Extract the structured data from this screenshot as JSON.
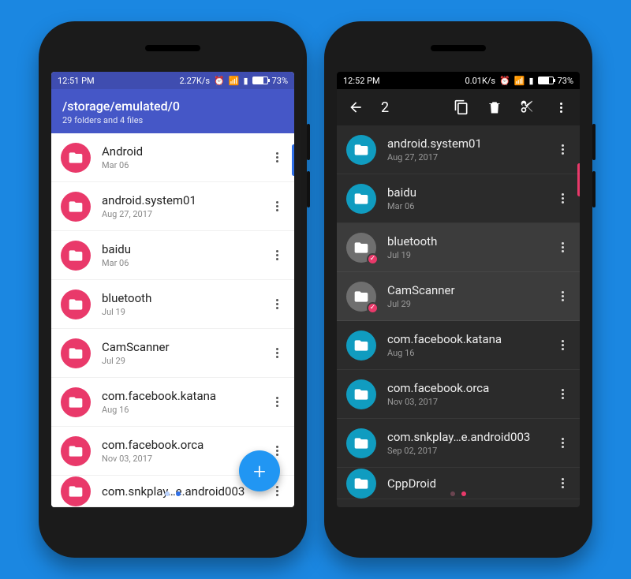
{
  "left": {
    "statusbar": {
      "time": "12:51 PM",
      "net_speed": "2.27K/s",
      "battery_pct": "73%"
    },
    "appbar": {
      "path": "/storage/emulated/0",
      "subtitle": "29 folders and 4 files"
    },
    "rows": [
      {
        "name": "Android",
        "date": "Mar 06"
      },
      {
        "name": "android.system01",
        "date": "Aug 27, 2017"
      },
      {
        "name": "baidu",
        "date": "Mar 06"
      },
      {
        "name": "bluetooth",
        "date": "Jul 19"
      },
      {
        "name": "CamScanner",
        "date": "Jul 29"
      },
      {
        "name": "com.facebook.katana",
        "date": "Aug 16"
      },
      {
        "name": "com.facebook.orca",
        "date": "Nov 03, 2017"
      },
      {
        "name": "com.snkplay…e.android003",
        "date": ""
      }
    ]
  },
  "right": {
    "statusbar": {
      "time": "12:52 PM",
      "net_speed": "0.01K/s",
      "battery_pct": "73%"
    },
    "appbar": {
      "selection_count": "2"
    },
    "rows": [
      {
        "name": "android.system01",
        "date": "Aug 27, 2017",
        "selected": false
      },
      {
        "name": "baidu",
        "date": "Mar 06",
        "selected": false
      },
      {
        "name": "bluetooth",
        "date": "Jul 19",
        "selected": true
      },
      {
        "name": "CamScanner",
        "date": "Jul 29",
        "selected": true
      },
      {
        "name": "com.facebook.katana",
        "date": "Aug 16",
        "selected": false
      },
      {
        "name": "com.facebook.orca",
        "date": "Nov 03, 2017",
        "selected": false
      },
      {
        "name": "com.snkplay…e.android003",
        "date": "Sep 02, 2017",
        "selected": false
      },
      {
        "name": "CppDroid",
        "date": "",
        "selected": false
      }
    ]
  }
}
